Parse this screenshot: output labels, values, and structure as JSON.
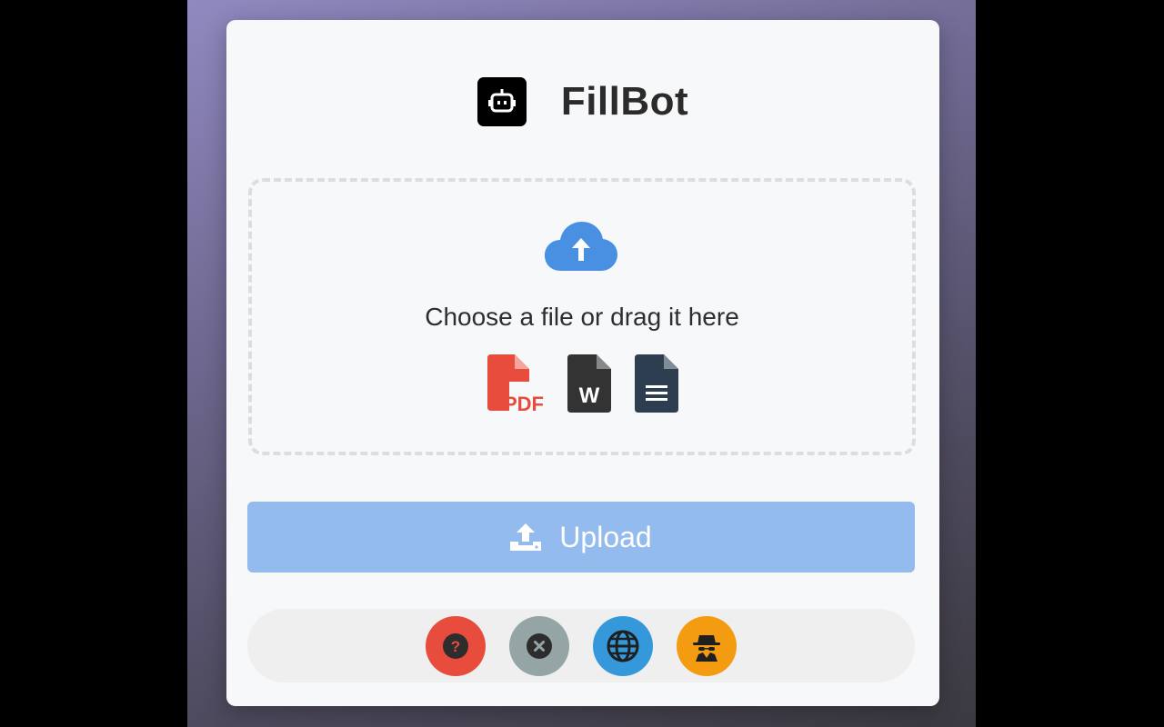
{
  "app": {
    "title": "FillBot",
    "logo_icon": "robot-icon"
  },
  "dropzone": {
    "text": "Choose a file or drag it here",
    "icon": "cloud-upload-icon",
    "file_types": [
      {
        "icon": "pdf-file-icon",
        "label": "PDF",
        "color": "#e74c3c"
      },
      {
        "icon": "word-file-icon",
        "label": "W",
        "color": "#333333"
      },
      {
        "icon": "text-file-icon",
        "color": "#2c3e50"
      }
    ]
  },
  "upload": {
    "label": "Upload",
    "icon": "upload-icon",
    "color": "#94bbee"
  },
  "toolbar": [
    {
      "icon": "help-icon",
      "color": "#e74c3c"
    },
    {
      "icon": "close-icon",
      "color": "#95a5a6"
    },
    {
      "icon": "globe-icon",
      "color": "#3498db"
    },
    {
      "icon": "incognito-icon",
      "color": "#f39c12"
    }
  ]
}
